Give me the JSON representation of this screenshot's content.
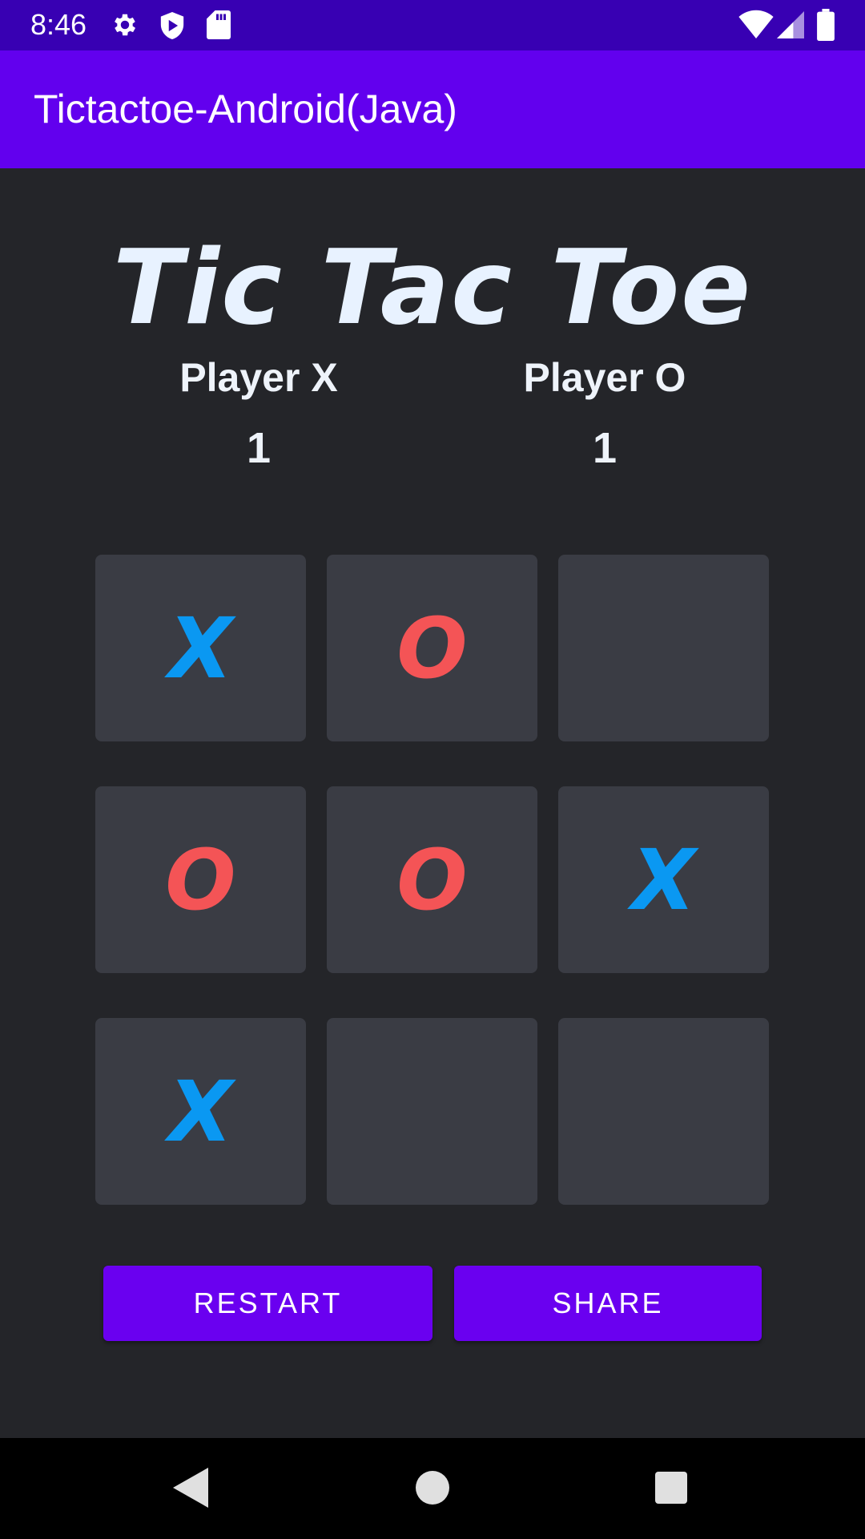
{
  "status_bar": {
    "time": "8:46",
    "icons": [
      "gear-icon",
      "shield-play-icon",
      "sd-card-icon",
      "wifi-icon",
      "signal-icon",
      "battery-icon"
    ]
  },
  "app_bar": {
    "title": "Tictactoe-Android(Java)"
  },
  "game": {
    "title": "Tic Tac Toe",
    "player_x": {
      "label": "Player X",
      "score": "1"
    },
    "player_o": {
      "label": "Player O",
      "score": "1"
    },
    "board": [
      [
        "X",
        "O",
        ""
      ],
      [
        "O",
        "O",
        "X"
      ],
      [
        "X",
        "",
        ""
      ]
    ]
  },
  "actions": {
    "restart": "RESTART",
    "share": "SHARE"
  },
  "nav_bar": {
    "icons": [
      "back-icon",
      "home-icon",
      "recents-icon"
    ]
  },
  "colors": {
    "status_bar": "#3800b3",
    "app_bar": "#6200ee",
    "background": "#242529",
    "cell": "#3a3c44",
    "x_mark": "#0a98f2",
    "o_mark": "#f45456",
    "button": "#6a00f0"
  }
}
